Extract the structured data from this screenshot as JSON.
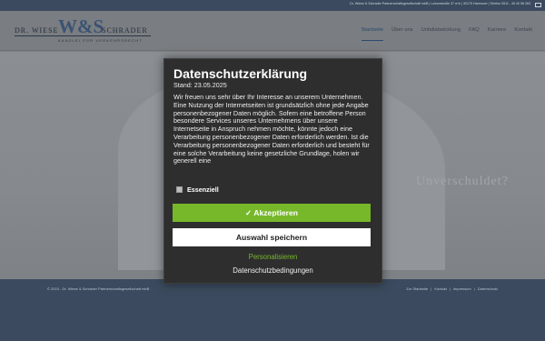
{
  "topbar": {
    "text": "Dr. Wiese & Schrader Partnerschaftsgesellschaft mbB | Luisenstraße 37 a+b | 30175 Hannover | Telefon 0511 - 45 40 58 263",
    "mail_icon": "mail-icon"
  },
  "logo": {
    "left": "DR. WIESE",
    "mark": "W&S",
    "right": "SCHRADER",
    "sub": "KANZLEI FÜR VERKEHRSRECHT"
  },
  "nav": {
    "items": [
      {
        "label": "Startseite"
      },
      {
        "label": "Über uns"
      },
      {
        "label": "Unfallabwicklung"
      },
      {
        "label": "FAQ"
      },
      {
        "label": "Karriere"
      },
      {
        "label": "Kontakt"
      }
    ]
  },
  "hero": {
    "text": "Unverschuldet?"
  },
  "footer": {
    "copyright": "© 2024 - Dr. Wiese & Schrader Partnerschaftsgesellschaft mbB",
    "links": [
      {
        "label": "Zur Startseite"
      },
      {
        "label": "Kontakt"
      },
      {
        "label": "Impressum"
      },
      {
        "label": "Datenschutz"
      }
    ],
    "separator": "|"
  },
  "consent": {
    "title": "Datenschutzerklärung",
    "stand": "Stand: 23.05.2025",
    "body": "Wir freuen uns sehr über Ihr Interesse an unserem Unternehmen. Eine Nutzung der Internetseiten ist grundsätzlich ohne jede Angabe personenbezogener Daten möglich. Sofern eine betroffene Person besondere Services unseres Unternehmens über unsere Internetseite in Anspruch nehmen möchte, könnte jedoch eine Verarbeitung personenbezogener Daten erforderlich werden. Ist die Verarbeitung personenbezogener Daten erforderlich und besteht für eine solche Verarbeitung keine gesetzliche Grundlage, holen wir generell eine",
    "essential_label": "Essenziell",
    "accept_label": "✓ Akzeptieren",
    "save_label": "Auswahl speichern",
    "personalize_label": "Personalisieren",
    "privacy_link": "Datenschutzbedingungen",
    "accent_color": "#76b82a"
  }
}
